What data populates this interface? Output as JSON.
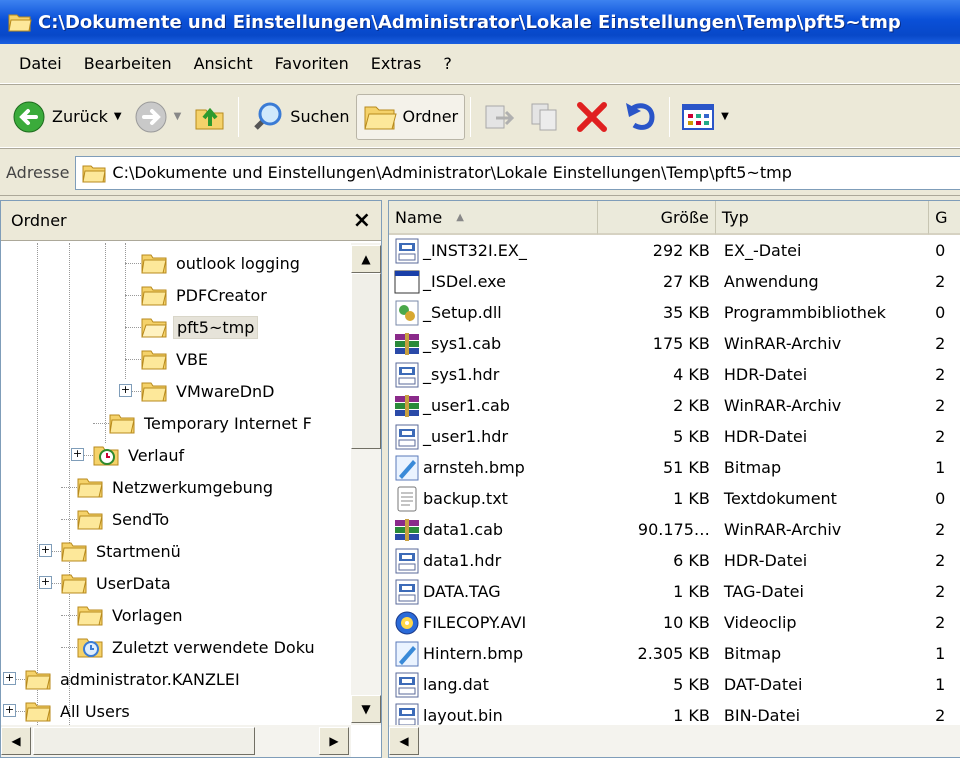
{
  "window": {
    "title": "C:\\Dokumente und Einstellungen\\Administrator\\Lokale Einstellungen\\Temp\\pft5~tmp"
  },
  "menu": [
    "Datei",
    "Bearbeiten",
    "Ansicht",
    "Favoriten",
    "Extras",
    "?"
  ],
  "toolbar": {
    "back_label": "Zurück",
    "search_label": "Suchen",
    "folders_label": "Ordner"
  },
  "address": {
    "label": "Adresse",
    "value": "C:\\Dokumente und Einstellungen\\Administrator\\Lokale Einstellungen\\Temp\\pft5~tmp"
  },
  "tree": {
    "title": "Ordner",
    "close": "×",
    "nodes": [
      {
        "label": "outlook logging",
        "icon": "folder-icon"
      },
      {
        "label": "PDFCreator",
        "icon": "folder-icon"
      },
      {
        "label": "pft5~tmp",
        "icon": "folder-open-icon",
        "selected": true
      },
      {
        "label": "VBE",
        "icon": "folder-icon"
      },
      {
        "label": "VMwareDnD",
        "icon": "folder-icon",
        "expander": "+"
      },
      {
        "label": "Temporary Internet F",
        "icon": "folder-icon"
      },
      {
        "label": "Verlauf",
        "icon": "history-icon",
        "expander": "+"
      },
      {
        "label": "Netzwerkumgebung",
        "icon": "folder-icon"
      },
      {
        "label": "SendTo",
        "icon": "folder-icon"
      },
      {
        "label": "Startmenü",
        "icon": "folder-icon",
        "expander": "+"
      },
      {
        "label": "UserData",
        "icon": "folder-icon",
        "expander": "+"
      },
      {
        "label": "Vorlagen",
        "icon": "folder-icon"
      },
      {
        "label": "Zuletzt verwendete Doku",
        "icon": "recent-icon"
      },
      {
        "label": "administrator.KANZLEI",
        "icon": "folder-icon",
        "expander": "+"
      },
      {
        "label": "All Users",
        "icon": "folder-icon",
        "expander": "+"
      }
    ]
  },
  "files": {
    "columns": [
      "Name",
      "Größe",
      "Typ",
      "G"
    ],
    "sort_indicator": "▲",
    "rows": [
      {
        "name": "_INST32I.EX_",
        "size": "292 KB",
        "type": "EX_-Datei",
        "date": "0",
        "icon": "file-icon"
      },
      {
        "name": "_ISDel.exe",
        "size": "27 KB",
        "type": "Anwendung",
        "date": "2",
        "icon": "exe-icon"
      },
      {
        "name": "_Setup.dll",
        "size": "35 KB",
        "type": "Programmbibliothek",
        "date": "0",
        "icon": "dll-icon"
      },
      {
        "name": "_sys1.cab",
        "size": "175 KB",
        "type": "WinRAR-Archiv",
        "date": "2",
        "icon": "rar-icon"
      },
      {
        "name": "_sys1.hdr",
        "size": "4 KB",
        "type": "HDR-Datei",
        "date": "2",
        "icon": "file-icon"
      },
      {
        "name": "_user1.cab",
        "size": "2 KB",
        "type": "WinRAR-Archiv",
        "date": "2",
        "icon": "rar-icon"
      },
      {
        "name": "_user1.hdr",
        "size": "5 KB",
        "type": "HDR-Datei",
        "date": "2",
        "icon": "file-icon"
      },
      {
        "name": "arnsteh.bmp",
        "size": "51 KB",
        "type": "Bitmap",
        "date": "1",
        "icon": "bitmap-icon"
      },
      {
        "name": "backup.txt",
        "size": "1 KB",
        "type": "Textdokument",
        "date": "0",
        "icon": "text-icon"
      },
      {
        "name": "data1.cab",
        "size": "90.175…",
        "type": "WinRAR-Archiv",
        "date": "2",
        "icon": "rar-icon"
      },
      {
        "name": "data1.hdr",
        "size": "6 KB",
        "type": "HDR-Datei",
        "date": "2",
        "icon": "file-icon"
      },
      {
        "name": "DATA.TAG",
        "size": "1 KB",
        "type": "TAG-Datei",
        "date": "2",
        "icon": "file-icon"
      },
      {
        "name": "FILECOPY.AVI",
        "size": "10 KB",
        "type": "Videoclip",
        "date": "2",
        "icon": "video-icon"
      },
      {
        "name": "Hintern.bmp",
        "size": "2.305 KB",
        "type": "Bitmap",
        "date": "1",
        "icon": "bitmap-icon"
      },
      {
        "name": "lang.dat",
        "size": "5 KB",
        "type": "DAT-Datei",
        "date": "1",
        "icon": "file-icon"
      },
      {
        "name": "layout.bin",
        "size": "1 KB",
        "type": "BIN-Datei",
        "date": "2",
        "icon": "file-icon"
      }
    ]
  }
}
